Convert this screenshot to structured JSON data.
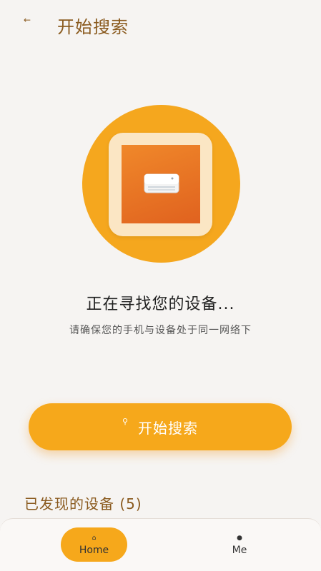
{
  "header": {
    "back_icon": "arrow-left-icon",
    "title": "开始搜索"
  },
  "status": {
    "title": "正在寻找您的设备...",
    "subtitle": "请确保您的手机与设备处于同一网络下"
  },
  "search_button": {
    "icon": "search-icon",
    "label": "开始搜索"
  },
  "discovered": {
    "title": "已发现的设备 (5)"
  },
  "bottom_nav": {
    "items": [
      {
        "label": "Home",
        "icon": "home-icon",
        "active": true
      },
      {
        "label": "Me",
        "icon": "person-icon",
        "active": false
      }
    ]
  },
  "colors": {
    "accent": "#f6a81b",
    "title_brown": "#8a5a1e",
    "background": "#f6f4f2"
  }
}
